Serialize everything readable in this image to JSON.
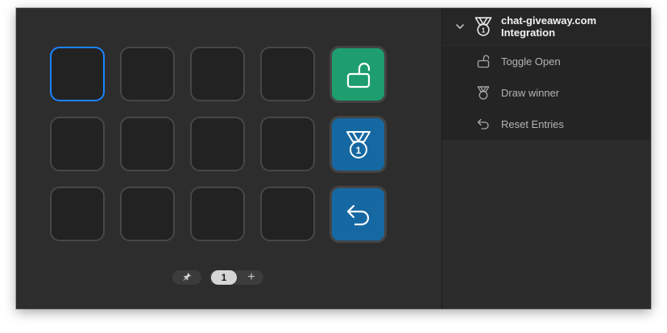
{
  "plugin": {
    "title_line1": "chat-giveaway.com",
    "title_line2": "Integration",
    "icon": "medal-icon",
    "expanded": true
  },
  "actions": [
    {
      "label": "Toggle Open",
      "icon": "unlock-icon"
    },
    {
      "label": "Draw winner",
      "icon": "medal-icon"
    },
    {
      "label": "Reset Entries",
      "icon": "undo-arrow-icon"
    }
  ],
  "grid": {
    "rows": 3,
    "columns": 5,
    "selected_key": "row-1-col-1",
    "assigned_keys": [
      {
        "key": "row-1-col-5",
        "action": "Toggle Open",
        "icon": "unlock-icon",
        "color": "#1e9e6e"
      },
      {
        "key": "row-2-col-5",
        "action": "Draw winner",
        "icon": "medal-icon",
        "color": "#1668a3"
      },
      {
        "key": "row-3-col-5",
        "action": "Reset Entries",
        "icon": "undo-arrow-icon",
        "color": "#1668a3"
      }
    ]
  },
  "pager": {
    "pin_icon": "pin-icon",
    "current_page": "1",
    "add_label": "+"
  },
  "colors": {
    "accent_selection": "#1a84ff",
    "green_key": "#1e9e6e",
    "blue_key": "#1668a3"
  }
}
